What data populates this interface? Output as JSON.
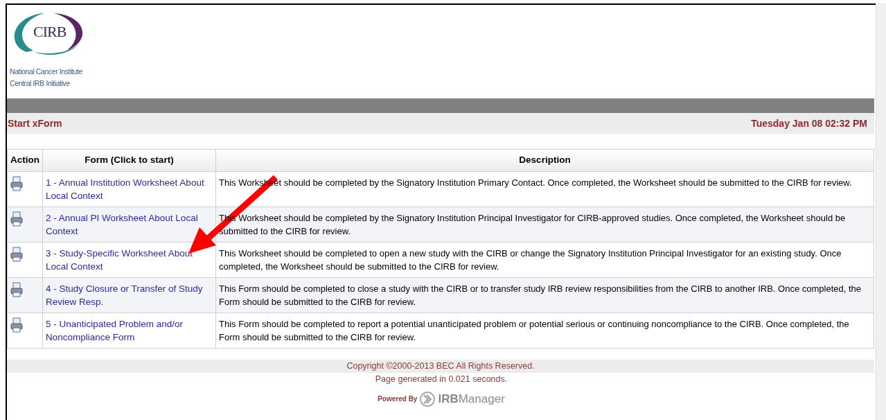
{
  "logo": {
    "mark": "CIRB",
    "lines": [
      "National Cancer Institute",
      "Central IRB Initiative"
    ]
  },
  "title_bar": {
    "title": "Start xForm",
    "datetime": "Tuesday Jan 08 02:32 PM"
  },
  "table": {
    "columns": [
      "Action",
      "Form (Click to start)",
      "Description"
    ],
    "rows": [
      {
        "form": "1 - Annual Institution Worksheet About Local Context",
        "description": "This Worksheet should be completed by the Signatory Institution Primary Contact. Once completed, the Worksheet should be submitted to the CIRB for review."
      },
      {
        "form": "2 - Annual PI Worksheet About Local Context",
        "description": "This Worksheet should be completed by the Signatory Institution Principal Investigator for CIRB-approved studies. Once completed, the Worksheet should be submitted to the CIRB for review."
      },
      {
        "form": "3 - Study-Specific Worksheet About Local Context",
        "description": "This Worksheet should be completed to open a new study with the CIRB or change the Signatory Institution Principal Investigator for an existing study. Once completed, the Worksheet should be submitted to the CIRB for review."
      },
      {
        "form": "4 - Study Closure or Transfer of Study Review Resp.",
        "description": "This Form should be completed to close a study with the CIRB or to transfer study IRB review responsibilities from the CIRB to another IRB. Once completed, the Form should be submitted to the CIRB for review."
      },
      {
        "form": "5 - Unanticipated Problem and/or Noncompliance Form",
        "description": "This Form should be completed to report a potential unanticipated problem or potential serious or continuing noncompliance to the CIRB. Once completed, the Form should be submitted to the CIRB for review."
      }
    ]
  },
  "footer": {
    "copyright": "Copyright ©2000-2013 BEC All Rights Reserved.",
    "generated": "Page generated in 0.021 seconds.",
    "powered_by": "Powered By",
    "brand": "**IRB**Manager"
  }
}
